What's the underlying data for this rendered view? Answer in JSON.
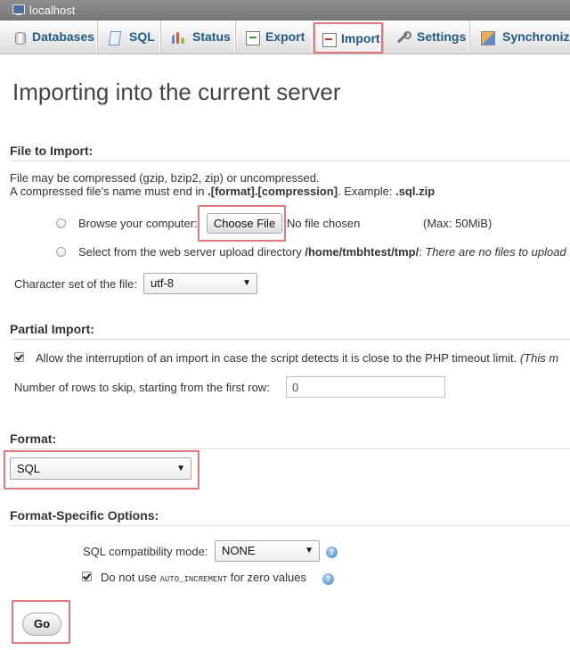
{
  "server": {
    "label": "localhost",
    "icon": "server-icon"
  },
  "tabs": [
    {
      "label": "Databases",
      "icon": "database-icon"
    },
    {
      "label": "SQL",
      "icon": "sql-icon"
    },
    {
      "label": "Status",
      "icon": "status-icon"
    },
    {
      "label": "Export",
      "icon": "export-icon"
    },
    {
      "label": "Import",
      "icon": "import-icon",
      "active": true
    },
    {
      "label": "Settings",
      "icon": "settings-icon"
    },
    {
      "label": "Synchronize",
      "icon": "synchronize-icon"
    }
  ],
  "page_title": "Importing into the current server",
  "file_import": {
    "title": "File to Import:",
    "note_line1": "File may be compressed (gzip, bzip2, zip) or uncompressed.",
    "note_line2_prefix": "A compressed file's name must end in ",
    "note_line2_format": ".[format].[compression]",
    "note_line2_middle": ". Example: ",
    "note_line2_example": ".sql.zip",
    "browse_label": "Browse your computer:",
    "choose_file_button": "Choose File",
    "no_file_text": "No file chosen",
    "max_size": "(Max: 50MiB)",
    "server_dir_label": "Select from the web server upload directory ",
    "server_dir_path": "/home/tmbhtest/tmp/",
    "server_dir_colon": ": ",
    "server_dir_note": "There are no files to upload",
    "charset_label": "Character set of the file:",
    "charset_value": "utf-8"
  },
  "partial_import": {
    "title": "Partial Import:",
    "allow_interrupt_label": "Allow the interruption of an import in case the script detects it is close to the PHP timeout limit. ",
    "allow_interrupt_note": "(This m",
    "allow_interrupt_checked": true,
    "skip_rows_label": "Number of rows to skip, starting from the first row:",
    "skip_rows_value": "0"
  },
  "format": {
    "title": "Format:",
    "value": "SQL"
  },
  "format_options": {
    "title": "Format-Specific Options:",
    "compat_label": "SQL compatibility mode:",
    "compat_value": "NONE",
    "no_auto_inc_prefix": "Do not use ",
    "no_auto_inc_code": "AUTO_INCREMENT",
    "no_auto_inc_suffix": " for zero values",
    "no_auto_inc_checked": true
  },
  "go_button": "Go",
  "colors": {
    "link": "#235a81",
    "highlight": "#e2787e",
    "topbar": "#858585"
  }
}
